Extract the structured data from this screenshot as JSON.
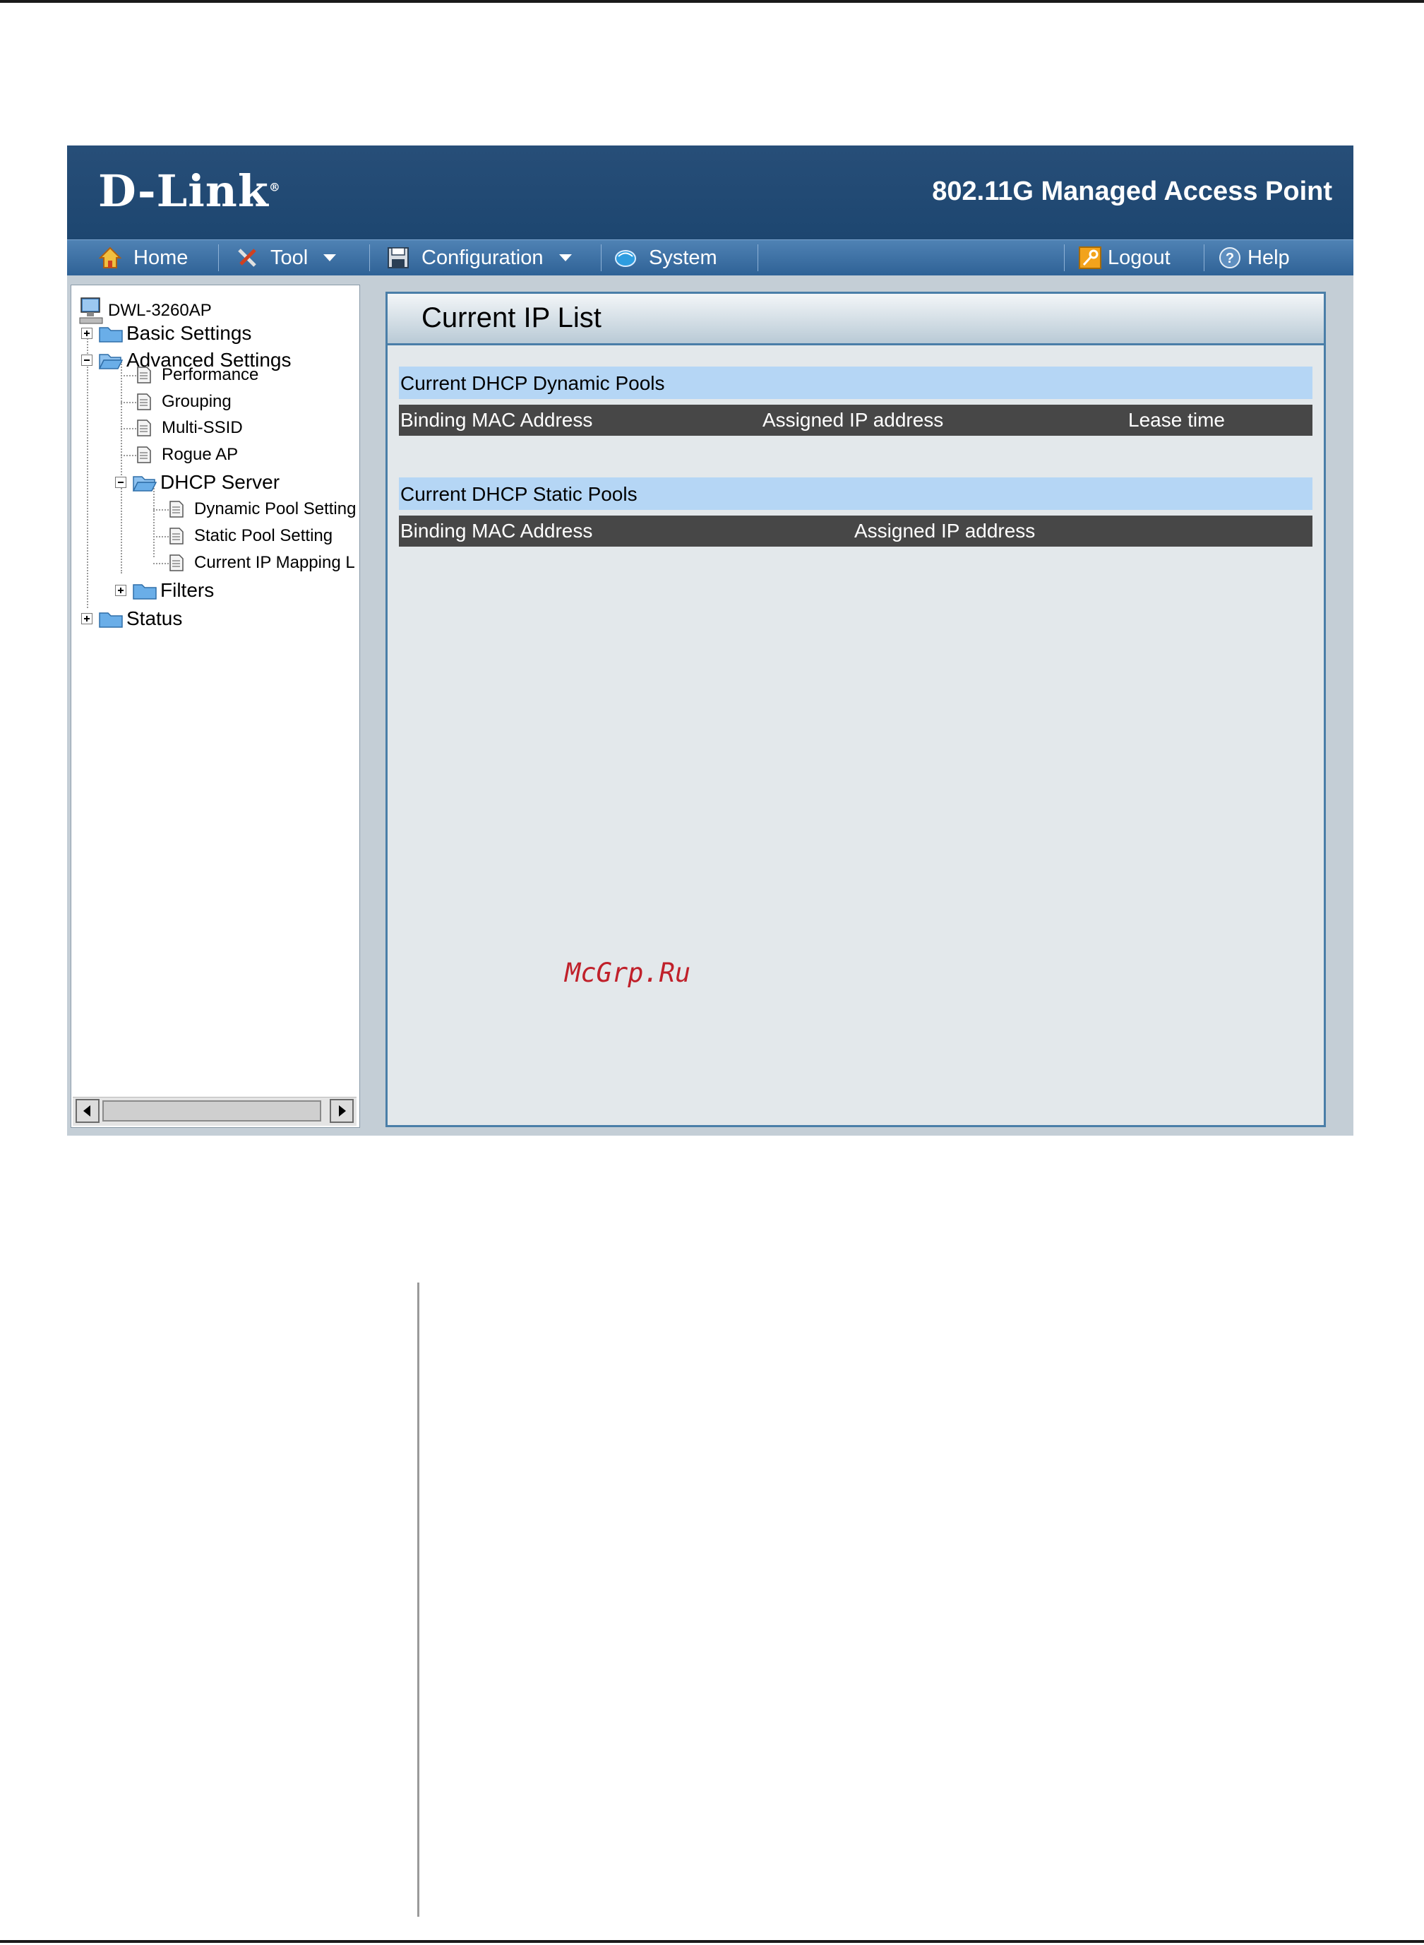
{
  "header": {
    "logo_text": "D-Link",
    "logo_mark": "®",
    "product_title": "802.11G Managed Access Point"
  },
  "menubar": {
    "items": [
      {
        "label": "Home",
        "icon": "home-icon"
      },
      {
        "label": "Tool",
        "icon": "tool-icon"
      },
      {
        "label": "Configuration",
        "icon": "save-disk-icon"
      },
      {
        "label": "System",
        "icon": "system-globe-icon"
      }
    ],
    "right_items": [
      {
        "label": "Logout",
        "icon": "logout-key-icon"
      },
      {
        "label": "Help",
        "icon": "help-icon"
      }
    ]
  },
  "tree": {
    "root": "DWL-3260AP",
    "basic_settings": "Basic Settings",
    "advanced_settings": "Advanced Settings",
    "performance": "Performance",
    "grouping": "Grouping",
    "multi_ssid": "Multi-SSID",
    "rogue_ap": "Rogue AP",
    "dhcp_server": "DHCP Server",
    "dynamic_pool_setting": "Dynamic Pool Setting",
    "static_pool_setting": "Static Pool Setting",
    "current_ip_mapping": "Current IP Mapping L",
    "filters": "Filters",
    "status": "Status"
  },
  "content": {
    "title": "Current IP List",
    "dynamic": {
      "heading": "Current DHCP Dynamic Pools",
      "columns": [
        "Binding MAC Address",
        "Assigned IP address",
        "Lease time"
      ]
    },
    "static": {
      "heading": "Current DHCP Static Pools",
      "columns": [
        "Binding MAC Address",
        "Assigned IP address"
      ]
    }
  },
  "watermark": "McGrp.Ru",
  "colors": {
    "header_bg": "#274e78",
    "menubar_bg": "#3a6ea2",
    "section_header_bg": "#b5d6f5",
    "column_header_bg": "#474747",
    "content_bg": "#e3e8eb",
    "watermark": "#c0202a"
  }
}
